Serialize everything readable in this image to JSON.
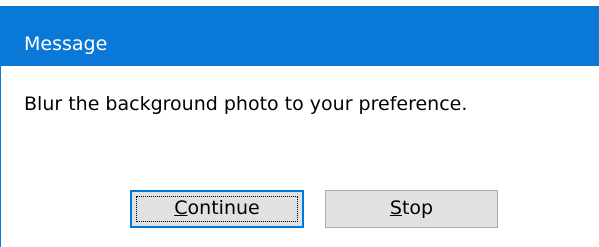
{
  "window": {
    "title": "Message"
  },
  "body": {
    "message": "Blur the background photo to your preference."
  },
  "buttons": {
    "continue": {
      "mnemonic": "C",
      "rest": "ontinue"
    },
    "stop": {
      "mnemonic": "S",
      "rest": "top"
    }
  },
  "colors": {
    "titlebar": "#0a78d7",
    "button_face": "#e1e1e1",
    "focus_border": "#0078d7"
  }
}
